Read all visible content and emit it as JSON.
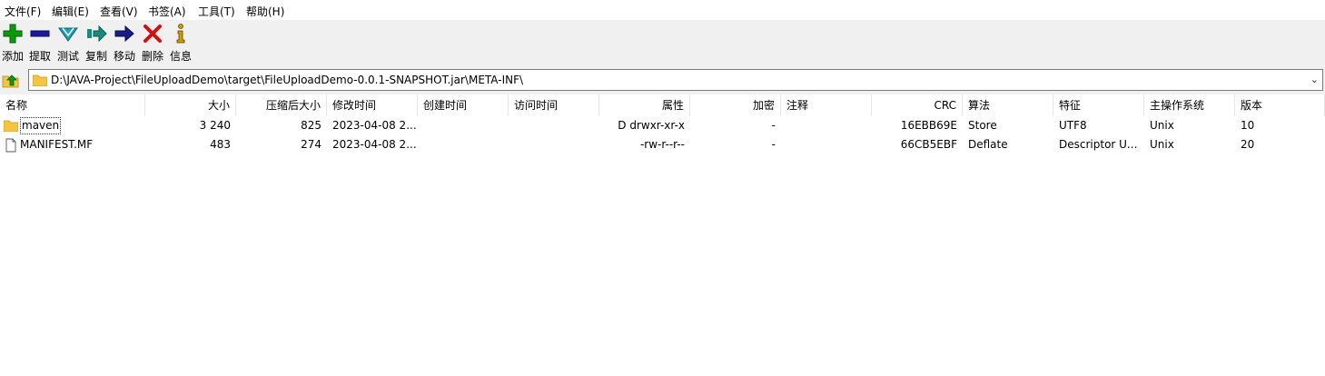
{
  "menubar": {
    "items": [
      "文件(F)",
      "编辑(E)",
      "查看(V)",
      "书签(A)",
      "工具(T)",
      "帮助(H)"
    ]
  },
  "toolbar": {
    "buttons": [
      {
        "label": "添加",
        "icon": "add-icon"
      },
      {
        "label": "提取",
        "icon": "extract-icon"
      },
      {
        "label": "测试",
        "icon": "test-icon"
      },
      {
        "label": "复制",
        "icon": "copy-icon"
      },
      {
        "label": "移动",
        "icon": "move-icon"
      },
      {
        "label": "删除",
        "icon": "delete-icon"
      },
      {
        "label": "信息",
        "icon": "info-icon"
      }
    ]
  },
  "address": {
    "path": "D:\\JAVA-Project\\FileUploadDemo\\target\\FileUploadDemo-0.0.1-SNAPSHOT.jar\\META-INF\\"
  },
  "table": {
    "columns": [
      "名称",
      "大小",
      "压缩后大小",
      "修改时间",
      "创建时间",
      "访问时间",
      "属性",
      "加密",
      "注释",
      "CRC",
      "算法",
      "特征",
      "主操作系统",
      "版本"
    ],
    "rows": [
      {
        "name": "maven",
        "type": "folder",
        "size": "3 240",
        "packed": "825",
        "modified": "2023-04-08 2...",
        "created": "",
        "accessed": "",
        "attributes": "D drwxr-xr-x",
        "encrypted": "-",
        "comment": "",
        "crc": "16EBB69E",
        "method": "Store",
        "characteristics": "UTF8",
        "host_os": "Unix",
        "version": "10"
      },
      {
        "name": "MANIFEST.MF",
        "type": "file",
        "size": "483",
        "packed": "274",
        "modified": "2023-04-08 2...",
        "created": "",
        "accessed": "",
        "attributes": "-rw-r--r--",
        "encrypted": "-",
        "comment": "",
        "crc": "66CB5EBF",
        "method": "Deflate",
        "characteristics": "Descriptor U...",
        "host_os": "Unix",
        "version": "20"
      }
    ]
  },
  "colors": {
    "toolbar_bg": "#f0f0f0",
    "add": "#0a9a0a",
    "extract": "#1a1a9a",
    "test": "#1aa0b8",
    "copy": "#1a8a7a",
    "move": "#1a1a8a",
    "delete": "#d01010",
    "info": "#c8a000",
    "folder": "#f5c542"
  }
}
